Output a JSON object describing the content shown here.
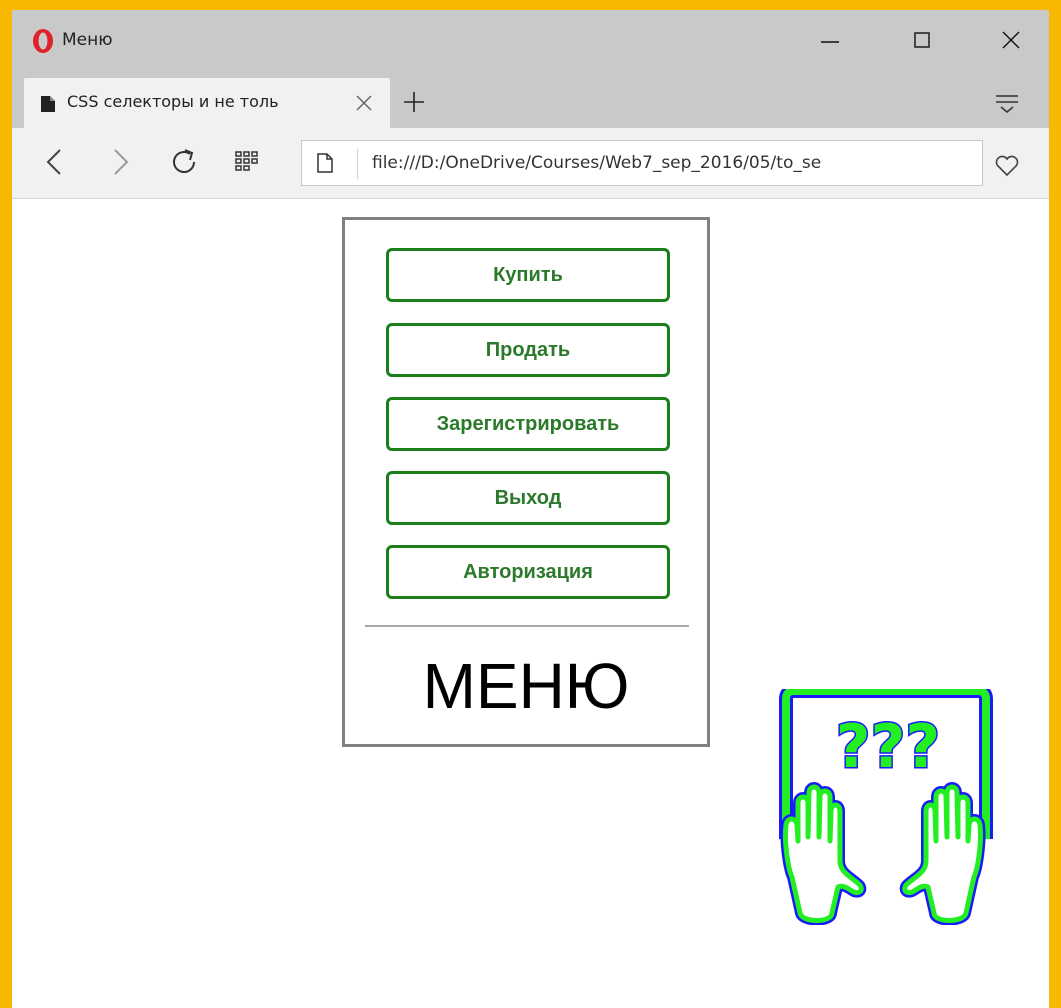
{
  "window": {
    "title": "Меню",
    "controls": {
      "minimize_icon": "minimize-icon",
      "maximize_icon": "maximize-icon",
      "close_icon": "close-icon"
    }
  },
  "tabs": [
    {
      "title": "CSS селекторы и не толь",
      "active": true
    }
  ],
  "toolbar": {
    "url": "file:///D:/OneDrive/Courses/Web7_sep_2016/05/to_se"
  },
  "page": {
    "menu_buttons": [
      "Купить",
      "Продать",
      "Зарегистрировать",
      "Выход",
      "Авторизация"
    ],
    "menu_caption": "МЕНЮ",
    "picture_text": "???"
  },
  "colors": {
    "frame": "#f7b900",
    "button_border": "#1a7e1a",
    "button_text": "#2b7a2b",
    "picture_stroke": "#1a1aff",
    "picture_fill": "#22ee22",
    "browser_chrome": "#c9c9c9"
  }
}
